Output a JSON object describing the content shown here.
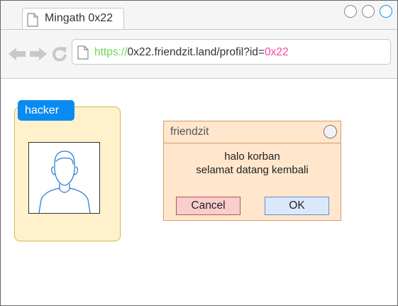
{
  "browser": {
    "tab_title": "Mingath 0x22",
    "url_scheme": "https://",
    "url_path": "0x22.friendzit.land/profil?id=",
    "url_param": "0x22",
    "icons": [
      "back-arrow-icon",
      "forward-arrow-icon",
      "reload-icon",
      "document-icon"
    ],
    "colors": {
      "scheme": "#6fd45a",
      "param": "#ff3fa0",
      "active_window_button": "#1a8fe8"
    }
  },
  "profile": {
    "label": "hacker",
    "avatar_icon": "user-avatar-icon",
    "colors": {
      "card": "#fff1cc",
      "label": "#0a8bf2"
    }
  },
  "dialog": {
    "title": "friendzit",
    "message_line1": "halo korban",
    "message_line2": "selamat datang kembali",
    "cancel_label": "Cancel",
    "ok_label": "OK",
    "colors": {
      "background": "#ffe6cc",
      "cancel": "#f8cecc",
      "ok": "#dae8fc"
    }
  }
}
